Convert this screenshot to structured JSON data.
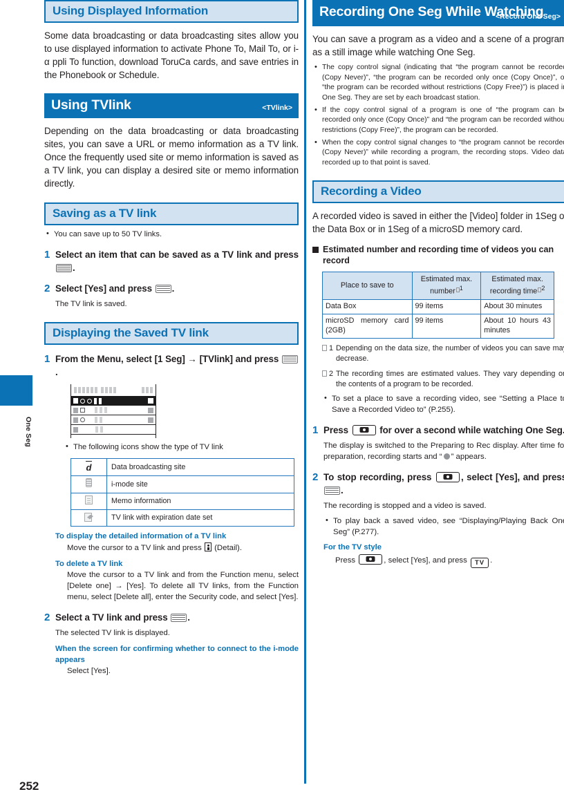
{
  "page": {
    "number": "252",
    "side_tab_label": "One Seg"
  },
  "left_column": {
    "heading_using_displayed_information": "Using Displayed Information",
    "intro_paragraph": "Some data broadcasting or data broadcasting sites allow you to use displayed information to activate Phone To, Mail To, or i-α ppli To function, download ToruCa cards, and save entries in the Phonebook or Schedule.",
    "heading_using_tvlink": "Using TVlink",
    "heading_using_tvlink_tag": "<TVlink>",
    "tvlink_paragraph": "Depending on the data broadcasting or data broadcasting sites, you can save a URL or memo information as a TV link. Once the frequently used site or memo information is saved as a TV link, you can display a desired site or memo information directly.",
    "heading_saving_as_tvlink": "Saving as a TV link",
    "saving_bullet": "You can save up to 50 TV links.",
    "saving_step1_pre": "Select an item that can be saved as a TV link and press",
    "saving_step1_post": ".",
    "saving_step1_num": "1",
    "saving_step2_num": "2",
    "saving_step2_pre": "Select [Yes] and press",
    "saving_step2_post": ".",
    "saving_step2_result": "The TV link is saved.",
    "heading_displaying_saved": "Displaying the Saved TV link",
    "display_step1_num": "1",
    "display_step1_pre": "From the Menu, select [1 Seg] → [TVlink] and press",
    "display_step1_post": ".",
    "icons_intro_bullet": "The following icons show the type of TV link",
    "icon_table": [
      {
        "icon": "data-broadcasting-icon",
        "label": "Data broadcasting site"
      },
      {
        "icon": "i-mode-site-icon",
        "label": "i-mode site"
      },
      {
        "icon": "memo-information-icon",
        "label": "Memo information"
      },
      {
        "icon": "expiration-date-icon",
        "label": "TV link with expiration date set"
      }
    ],
    "detail_heading": "To display the detailed information of a TV link",
    "detail_text_pre": "Move the cursor to a TV link and press",
    "detail_text_post": "(Detail).",
    "delete_heading": "To delete a TV link",
    "delete_text": "Move the cursor to a TV link and from the Function menu, select [Delete one] → [Yes]. To delete all TV links, from the Function menu, select [Delete all], enter the Security code, and select [Yes].",
    "display_step2_num": "2",
    "display_step2_pre": "Select a TV link and press",
    "display_step2_post": ".",
    "display_step2_result": "The selected TV link is displayed.",
    "imode_confirm_heading": "When the screen for confirming whether to connect to the i-mode appears",
    "imode_confirm_text": "Select [Yes]."
  },
  "right_column": {
    "heading_recording_one_seg": "Recording One Seg While Watching",
    "heading_recording_tag": "<Record One Seg>",
    "intro_paragraph": "You can save a program as a video and a scene of a program as a still image while watching One Seg.",
    "bullets": [
      "The copy control signal (indicating that “the program cannot be recorded (Copy Never)”, “the program can be recorded only once (Copy Once)”, or “the program can be recorded without restrictions (Copy Free)”) is placed in One Seg. They are set by each broadcast station.",
      "If the copy control signal of a program is one of “the program can be recorded only once (Copy Once)” and “the program can be recorded without restrictions (Copy Free)”, the program can be recorded.",
      "When the copy control signal changes to “the program cannot be recorded (Copy Never)” while recording a program, the recording stops. Video data recorded up to that point is saved."
    ],
    "heading_recording_video": "Recording a Video",
    "video_paragraph": "A recorded video is saved in either the [Video] folder in 1Seg of the Data Box or in 1Seg of a microSD memory card.",
    "estimated_heading": "Estimated number and recording time of videos you can record",
    "table": {
      "headers": [
        "Place to save to",
        "Estimated max. number",
        "Estimated max. recording time"
      ],
      "header_sup": [
        "",
        "1",
        "2"
      ],
      "rows": [
        [
          "Data Box",
          "99 items",
          "About 30 minutes"
        ],
        [
          "microSD memory card (2GB)",
          "99 items",
          "About 10 hours 43 minutes"
        ]
      ]
    },
    "footnote1_mark": "1",
    "footnote1": "Depending on the data size, the number of videos you can save may decrease.",
    "footnote2_mark": "2",
    "footnote2": "The recording times are estimated values. They vary depending on the contents of a program to be recorded.",
    "place_bullet": "To set a place to save a recording video, see “Setting a Place to Save a Recorded Video to” (P.255).",
    "rec_step1_num": "1",
    "rec_step1_pre": "Press",
    "rec_step1_post": "for over a second while watching One Seg.",
    "rec_step1_result_pre": "The display is switched to the Preparing to Rec display. After time for preparation, recording starts and “",
    "rec_step1_result_post": "” appears.",
    "rec_step2_num": "2",
    "rec_step2_a": "To stop recording, press",
    "rec_step2_b": ", select [Yes], and press",
    "rec_step2_c": ".",
    "rec_step2_result": "The recording is stopped and a video is saved.",
    "playback_bullet": "To play back a saved video, see “Displaying/Playing Back One Seg” (P.277).",
    "tv_style_heading": "For the TV style",
    "tv_style_pre": "Press",
    "tv_style_mid": ", select [Yes], and press",
    "tv_style_post": ".",
    "tv_key_label": "TV"
  },
  "colors": {
    "accent_blue": "#0b72b5",
    "light_blue_fill": "#d2e2f1",
    "table_border": "#2276bd",
    "text": "#231f20"
  }
}
